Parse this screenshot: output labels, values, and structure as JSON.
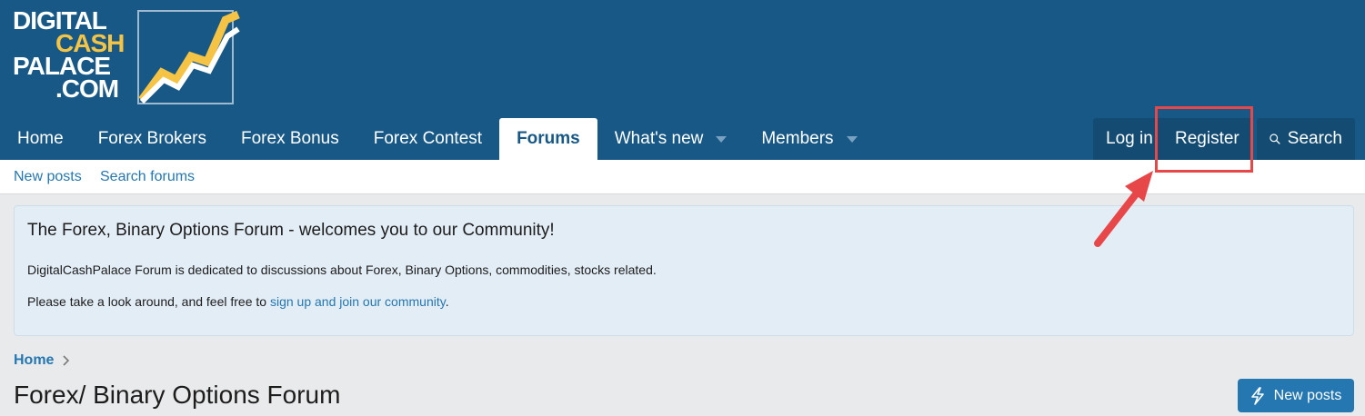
{
  "logo": {
    "line1": "DIGITAL",
    "line2": "CASH",
    "line3": "PALACE",
    "line4": ".COM"
  },
  "nav": {
    "tabs": [
      {
        "label": "Home"
      },
      {
        "label": "Forex Brokers"
      },
      {
        "label": "Forex Bonus"
      },
      {
        "label": "Forex Contest"
      },
      {
        "label": "Forums",
        "active": true
      },
      {
        "label": "What's new",
        "dropdown": true
      },
      {
        "label": "Members",
        "dropdown": true
      }
    ],
    "login_label": "Log in",
    "register_label": "Register",
    "search_label": "Search"
  },
  "subnav": {
    "new_posts": "New posts",
    "search_forums": "Search forums"
  },
  "notice": {
    "title": "The Forex, Binary Options Forum - welcomes you to our Community!",
    "paragraph1": "DigitalCashPalace Forum is dedicated to discussions about Forex, Binary Options, commodities, stocks related.",
    "paragraph2_prefix": "Please take a look around, and feel free to ",
    "paragraph2_link": "sign up and join our community",
    "paragraph2_suffix": "."
  },
  "breadcrumb": {
    "home": "Home"
  },
  "page": {
    "title": "Forex/ Binary Options Forum",
    "new_posts_button": "New posts"
  },
  "colors": {
    "header_bg": "#185886",
    "accent": "#2577b1",
    "highlight": "#e8474a",
    "logo_gold": "#f5c445"
  },
  "icons": {
    "search": "search-icon",
    "new_posts": "bolt-icon",
    "dropdown": "chevron-down-icon"
  }
}
